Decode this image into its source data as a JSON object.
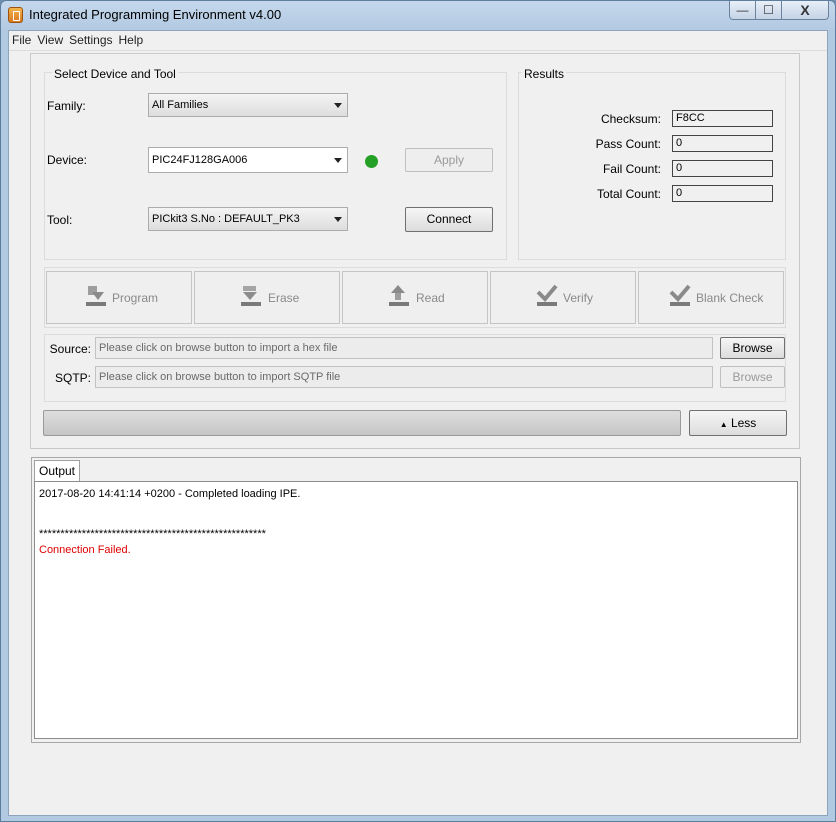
{
  "window": {
    "title": "Integrated Programming Environment v4.00",
    "minimize_glyph": "—",
    "maximize_glyph": "☐",
    "close_glyph": "X"
  },
  "menu": [
    "File",
    "View",
    "Settings",
    "Help"
  ],
  "device_tool": {
    "group_title": "Select Device and Tool",
    "family_label": "Family:",
    "family_value": "All Families",
    "device_label": "Device:",
    "device_value": "PIC24FJ128GA006",
    "device_status_color": "#23a025",
    "apply_label": "Apply",
    "tool_label": "Tool:",
    "tool_value": "PICkit3 S.No : DEFAULT_PK3",
    "connect_label": "Connect"
  },
  "results": {
    "group_title": "Results",
    "checksum_label": "Checksum:",
    "checksum_value": "F8CC",
    "pass_label": "Pass Count:",
    "pass_value": "0",
    "fail_label": "Fail Count:",
    "fail_value": "0",
    "total_label": "Total Count:",
    "total_value": "0"
  },
  "actions": [
    {
      "label": "Program",
      "icon": "program-icon"
    },
    {
      "label": "Erase",
      "icon": "erase-icon"
    },
    {
      "label": "Read",
      "icon": "read-icon"
    },
    {
      "label": "Verify",
      "icon": "verify-icon"
    },
    {
      "label": "Blank Check",
      "icon": "blank-check-icon"
    }
  ],
  "source": {
    "label": "Source:",
    "placeholder": "Please click on browse button to import a hex file",
    "browse_label": "Browse"
  },
  "sqtp": {
    "label": "SQTP:",
    "placeholder": "Please click on browse button to import SQTP file",
    "browse_label": "Browse"
  },
  "progress": {
    "value": 0
  },
  "less_button": {
    "glyph": "▲",
    "label": "Less"
  },
  "output": {
    "tab_label": "Output",
    "lines": [
      "2017-08-20 14:41:14 +0200 - Completed loading IPE.",
      "*****************************************************",
      "Connection Failed."
    ],
    "error_color": "#e00000"
  }
}
